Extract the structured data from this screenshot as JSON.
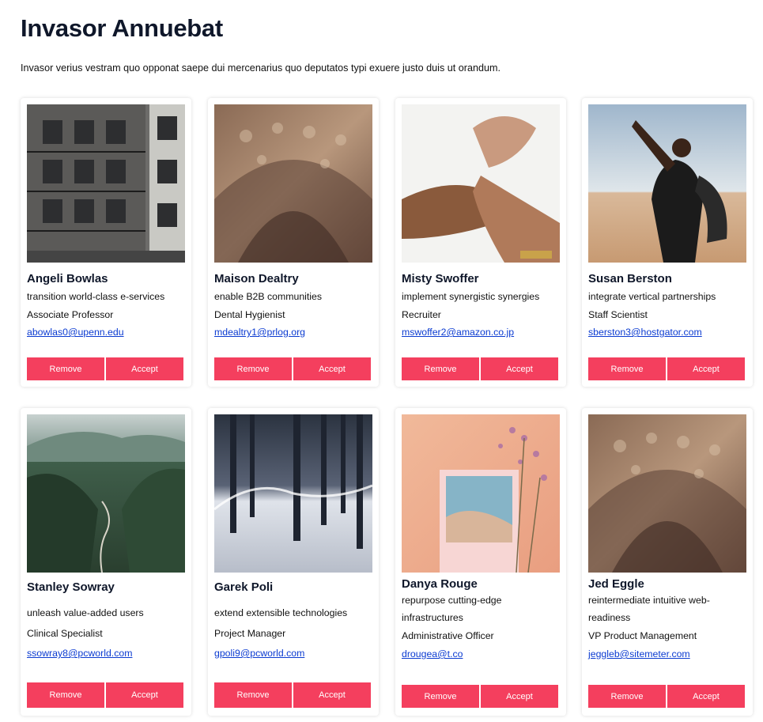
{
  "page": {
    "title": "Invasor Annuebat",
    "subtitle": "Invasor verius vestram quo opponat saepe dui mercenarius quo deputatos typi exuere justo duis ut orandum."
  },
  "cards": [
    {
      "name": "Angeli Bowlas",
      "tagline": "transition world-class e-services",
      "role": "Associate Professor",
      "email": "abowlas0@upenn.edu",
      "remove": "Remove",
      "accept": "Accept",
      "image": "building-photo"
    },
    {
      "name": "Maison Dealtry",
      "tagline": "enable B2B communities",
      "role": "Dental Hygienist",
      "email": "mdealtry1@prlog.org",
      "remove": "Remove",
      "accept": "Accept",
      "image": "arch-photo"
    },
    {
      "name": "Misty Swoffer",
      "tagline": "implement synergistic synergies",
      "role": "Recruiter",
      "email": "mswoffer2@amazon.co.jp",
      "remove": "Remove",
      "accept": "Accept",
      "image": "hands-photo"
    },
    {
      "name": "Susan Berston",
      "tagline": "integrate vertical partnerships",
      "role": "Staff Scientist",
      "email": "sberston3@hostgator.com",
      "remove": "Remove",
      "accept": "Accept",
      "image": "desert-portrait-photo"
    },
    {
      "name": "Stanley Sowray",
      "tagline": "unleash value-added users",
      "role": "Clinical Specialist",
      "email": "ssowray8@pcworld.com",
      "remove": "Remove",
      "accept": "Accept",
      "image": "valley-photo"
    },
    {
      "name": "Garek Poli",
      "tagline": "extend extensible technologies",
      "role": "Project Manager",
      "email": "gpoli9@pcworld.com",
      "remove": "Remove",
      "accept": "Accept",
      "image": "snow-forest-photo"
    },
    {
      "name": "Danya Rouge",
      "tagline": "repurpose cutting-edge infrastructures",
      "role": "Administrative Officer",
      "email": "drougea@t.co",
      "remove": "Remove",
      "accept": "Accept",
      "image": "polaroid-flowers-photo"
    },
    {
      "name": "Jed Eggle",
      "tagline": "reintermediate intuitive web-readiness",
      "role": "VP Product Management",
      "email": "jeggleb@sitemeter.com",
      "remove": "Remove",
      "accept": "Accept",
      "image": "arch-photo"
    }
  ],
  "colors": {
    "accent": "#f43f5e",
    "link": "#0b3bd1",
    "heading": "#0f172a"
  }
}
